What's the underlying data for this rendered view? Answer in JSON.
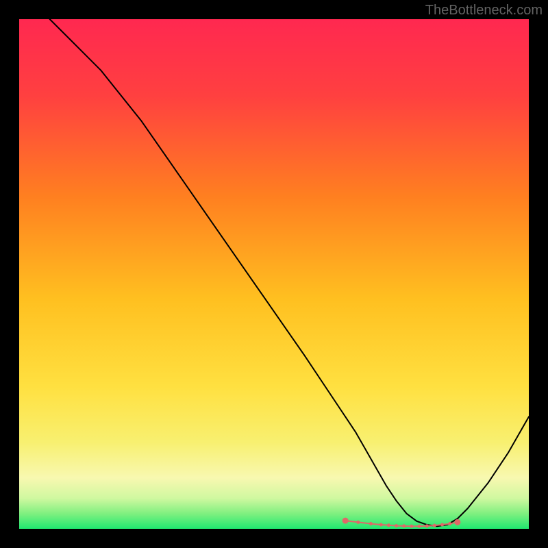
{
  "watermark": "TheBottleneck.com",
  "chart_data": {
    "type": "line",
    "title": "",
    "xlabel": "",
    "ylabel": "",
    "xlim": [
      0,
      100
    ],
    "ylim": [
      0,
      100
    ],
    "background": {
      "type": "vertical-gradient",
      "stops": [
        {
          "offset": 0.0,
          "color": "#ff2850"
        },
        {
          "offset": 0.15,
          "color": "#ff4040"
        },
        {
          "offset": 0.35,
          "color": "#ff8020"
        },
        {
          "offset": 0.55,
          "color": "#ffc020"
        },
        {
          "offset": 0.72,
          "color": "#ffe040"
        },
        {
          "offset": 0.83,
          "color": "#f8f070"
        },
        {
          "offset": 0.9,
          "color": "#f8f8b0"
        },
        {
          "offset": 0.94,
          "color": "#d0f8a0"
        },
        {
          "offset": 0.97,
          "color": "#80f080"
        },
        {
          "offset": 1.0,
          "color": "#20e870"
        }
      ]
    },
    "series": [
      {
        "name": "bottleneck-curve",
        "color": "#000000",
        "stroke_width": 2,
        "x": [
          6,
          10,
          16,
          24,
          32,
          40,
          48,
          56,
          62,
          64,
          66,
          68,
          70,
          72,
          74,
          76,
          78,
          80,
          82,
          84,
          86,
          88,
          92,
          96,
          100
        ],
        "y": [
          100,
          96,
          90,
          80,
          68.5,
          57,
          45.5,
          34,
          25,
          22,
          19,
          15.5,
          12,
          8.5,
          5.5,
          3,
          1.5,
          0.8,
          0.5,
          0.8,
          2,
          4,
          9,
          15,
          22
        ]
      }
    ],
    "markers": {
      "name": "optimal-range-markers",
      "color": "#e06868",
      "radius_end": 4.5,
      "radius_mid": 2.5,
      "x": [
        64,
        66.5,
        69,
        71,
        72.5,
        74,
        75.5,
        77,
        78.5,
        80,
        81.5,
        83,
        84.5,
        86
      ],
      "y": [
        1.6,
        1.3,
        1.0,
        0.8,
        0.7,
        0.6,
        0.55,
        0.5,
        0.5,
        0.55,
        0.65,
        0.8,
        1.0,
        1.3
      ],
      "is_end": [
        true,
        false,
        false,
        false,
        false,
        false,
        false,
        false,
        false,
        false,
        false,
        false,
        false,
        true
      ]
    }
  }
}
